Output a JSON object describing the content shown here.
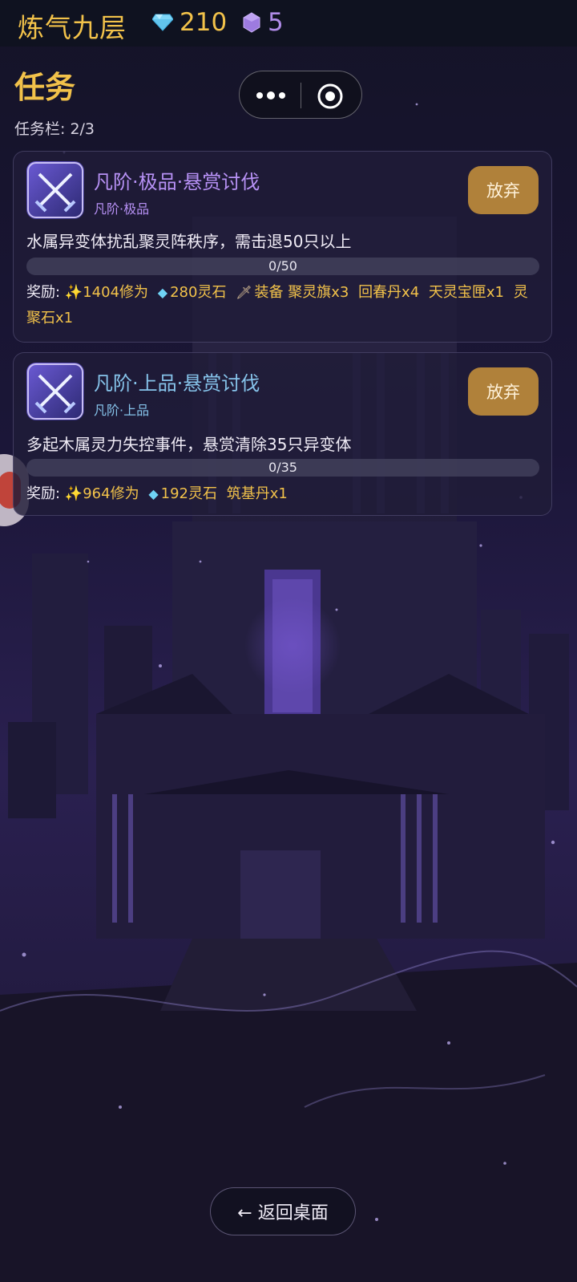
{
  "status_bar": {
    "realm": "炼气九层",
    "gems": "210",
    "crystals": "5",
    "gem_icon": "diamond-icon",
    "crystal_icon": "crystal-icon"
  },
  "page": {
    "title": "任务",
    "slots": "任务栏: 2/3",
    "back_label": "← 返回桌面"
  },
  "quests": [
    {
      "title": "凡阶·极品·悬赏讨伐",
      "subtitle": "凡阶·极品",
      "color": "#b791f5",
      "abandon_label": "放弃",
      "description": "水属异变体扰乱聚灵阵秩序，需击退50只以上",
      "progress_current": 0,
      "progress_total": 50,
      "progress_text": "0/50",
      "reward_label": "奖励:",
      "rewards": [
        "✨1404修为",
        "280灵石",
        "装备 聚灵旗x3",
        "回春丹x4",
        "天灵宝匣x1",
        "灵聚石x1"
      ]
    },
    {
      "title": "凡阶·上品·悬赏讨伐",
      "subtitle": "凡阶·上品",
      "color": "#86c3ea",
      "abandon_label": "放弃",
      "description": "多起木属灵力失控事件，悬赏清除35只异变体",
      "progress_current": 0,
      "progress_total": 35,
      "progress_text": "0/35",
      "reward_label": "奖励:",
      "rewards": [
        "✨964修为",
        "192灵石",
        "筑基丹x1"
      ]
    }
  ],
  "colors": {
    "accent_gold": "#f2c24a",
    "button_brown": "#b0813a",
    "background": "#120e24"
  }
}
